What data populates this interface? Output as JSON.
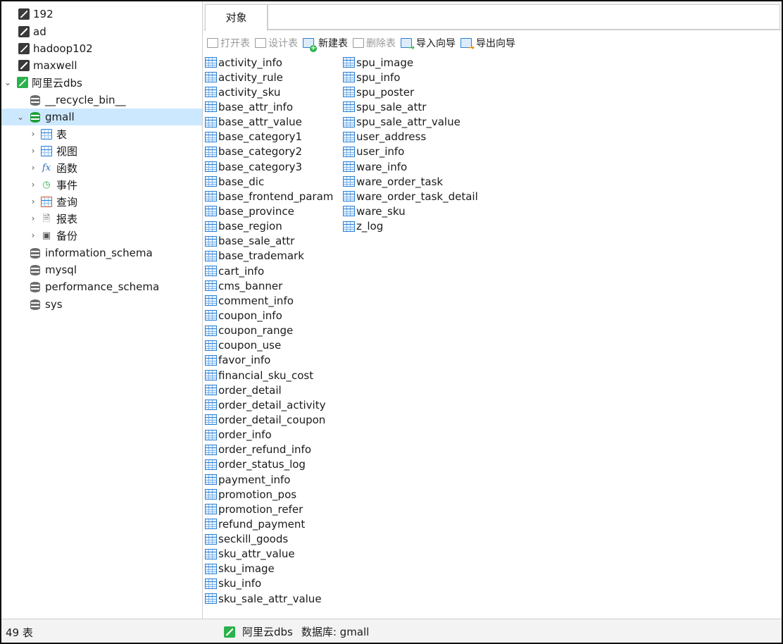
{
  "sidebar": {
    "connections": [
      {
        "label": "192",
        "icon": "connection-icon"
      },
      {
        "label": "ad",
        "icon": "connection-icon"
      },
      {
        "label": "hadoop102",
        "icon": "connection-icon"
      },
      {
        "label": "maxwell",
        "icon": "connection-icon"
      },
      {
        "label": "阿里云dbs",
        "icon": "connection-icon-active",
        "expanded": true
      }
    ],
    "databases": [
      {
        "label": "__recycle_bin__"
      },
      {
        "label": "gmall",
        "selected": true,
        "expanded": true
      },
      {
        "label": "information_schema"
      },
      {
        "label": "mysql"
      },
      {
        "label": "performance_schema"
      },
      {
        "label": "sys"
      }
    ],
    "gmall_children": [
      {
        "label": "表",
        "icon": "table-icon"
      },
      {
        "label": "视图",
        "icon": "view-icon"
      },
      {
        "label": "函数",
        "icon": "function-icon",
        "glyph": "fx"
      },
      {
        "label": "事件",
        "icon": "event-icon"
      },
      {
        "label": "查询",
        "icon": "query-icon"
      },
      {
        "label": "报表",
        "icon": "report-icon"
      },
      {
        "label": "备份",
        "icon": "backup-icon"
      }
    ]
  },
  "tabs": {
    "objects": "对象"
  },
  "toolbar": {
    "open_table": "打开表",
    "design_table": "设计表",
    "new_table": "新建表",
    "delete_table": "删除表",
    "import_wizard": "导入向导",
    "export_wizard": "导出向导"
  },
  "tables": [
    "activity_info",
    "activity_rule",
    "activity_sku",
    "base_attr_info",
    "base_attr_value",
    "base_category1",
    "base_category2",
    "base_category3",
    "base_dic",
    "base_frontend_param",
    "base_province",
    "base_region",
    "base_sale_attr",
    "base_trademark",
    "cart_info",
    "cms_banner",
    "comment_info",
    "coupon_info",
    "coupon_range",
    "coupon_use",
    "favor_info",
    "financial_sku_cost",
    "order_detail",
    "order_detail_activity",
    "order_detail_coupon",
    "order_info",
    "order_refund_info",
    "order_status_log",
    "payment_info",
    "promotion_pos",
    "promotion_refer",
    "refund_payment",
    "seckill_goods",
    "sku_attr_value",
    "sku_image",
    "sku_info",
    "sku_sale_attr_value",
    "spu_image",
    "spu_info",
    "spu_poster",
    "spu_sale_attr",
    "spu_sale_attr_value",
    "user_address",
    "user_info",
    "ware_info",
    "ware_order_task",
    "ware_order_task_detail",
    "ware_sku",
    "z_log"
  ],
  "statusbar": {
    "count": "49 表",
    "connection": "阿里云dbs",
    "database": "数据库: gmall"
  },
  "colors": {
    "selection": "#cce8ff",
    "accent_blue": "#2a7fd4",
    "connection_green": "#2bb24c"
  }
}
